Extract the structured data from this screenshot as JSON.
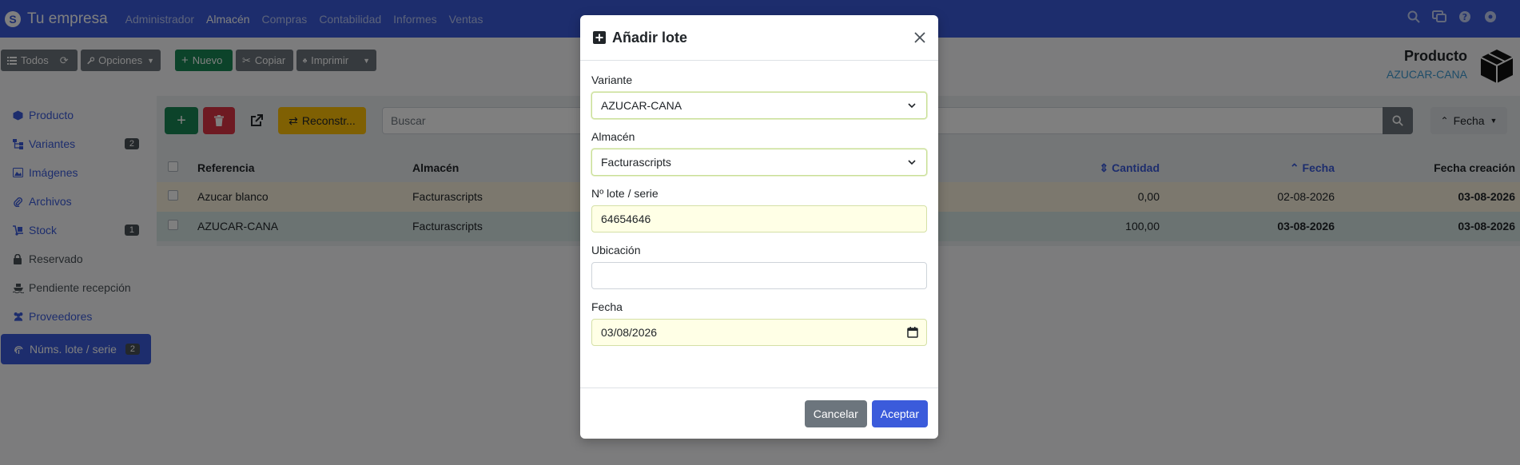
{
  "app": {
    "brand": "Tu empresa",
    "menu": [
      "Administrador",
      "Almacén",
      "Compras",
      "Contabilidad",
      "Informes",
      "Ventas"
    ],
    "active_menu": "Almacén"
  },
  "toolbar": {
    "all_label": "Todos",
    "options_label": "Opciones",
    "new_label": "Nuevo",
    "copy_label": "Copiar",
    "print_label": "Imprimir"
  },
  "product": {
    "title": "Producto",
    "reference": "AZUCAR-CANA"
  },
  "sidebar": {
    "items": [
      {
        "label": "Producto",
        "badge": ""
      },
      {
        "label": "Variantes",
        "badge": "2"
      },
      {
        "label": "Imágenes",
        "badge": ""
      },
      {
        "label": "Archivos",
        "badge": ""
      },
      {
        "label": "Stock",
        "badge": "1"
      },
      {
        "label": "Reservado",
        "badge": ""
      },
      {
        "label": "Pendiente recepción",
        "badge": ""
      },
      {
        "label": "Proveedores",
        "badge": ""
      },
      {
        "label": "Núms. lote / serie",
        "badge": "2"
      }
    ]
  },
  "list": {
    "rebuild_label": "Reconstr...",
    "search_placeholder": "Buscar",
    "sort_label": "Fecha",
    "columns": [
      "Referencia",
      "Almacén",
      "Cantidad",
      "Fecha",
      "Fecha creación"
    ],
    "rows": [
      {
        "referencia": "Azucar blanco",
        "almacen": "Facturascripts",
        "cantidad": "0,00",
        "fecha": "02-08-2026",
        "fecha_creacion": "03-08-2026"
      },
      {
        "referencia": "AZUCAR-CANA",
        "almacen": "Facturascripts",
        "cantidad": "100,00",
        "fecha": "03-08-2026",
        "fecha_creacion": "03-08-2026"
      }
    ]
  },
  "modal": {
    "title": "Añadir lote",
    "variant_label": "Variante",
    "variant_value": "AZUCAR-CANA",
    "warehouse_label": "Almacén",
    "warehouse_value": "Facturascripts",
    "lot_label": "Nº lote / serie",
    "lot_value": "64654646",
    "location_label": "Ubicación",
    "location_value": "",
    "date_label": "Fecha",
    "date_value": "03/08/2026",
    "cancel_label": "Cancelar",
    "accept_label": "Aceptar"
  },
  "colors": {
    "primary": "#3b5bdb",
    "success": "#198754",
    "danger": "#dc3545",
    "warning": "#ffc107",
    "secondary": "#6c757d"
  },
  "icons": [
    "search-icon",
    "chat-icon",
    "help-icon",
    "settings-icon",
    "close-icon",
    "plus-square-icon",
    "chevron-down-icon",
    "calendar-icon",
    "box-icon"
  ]
}
